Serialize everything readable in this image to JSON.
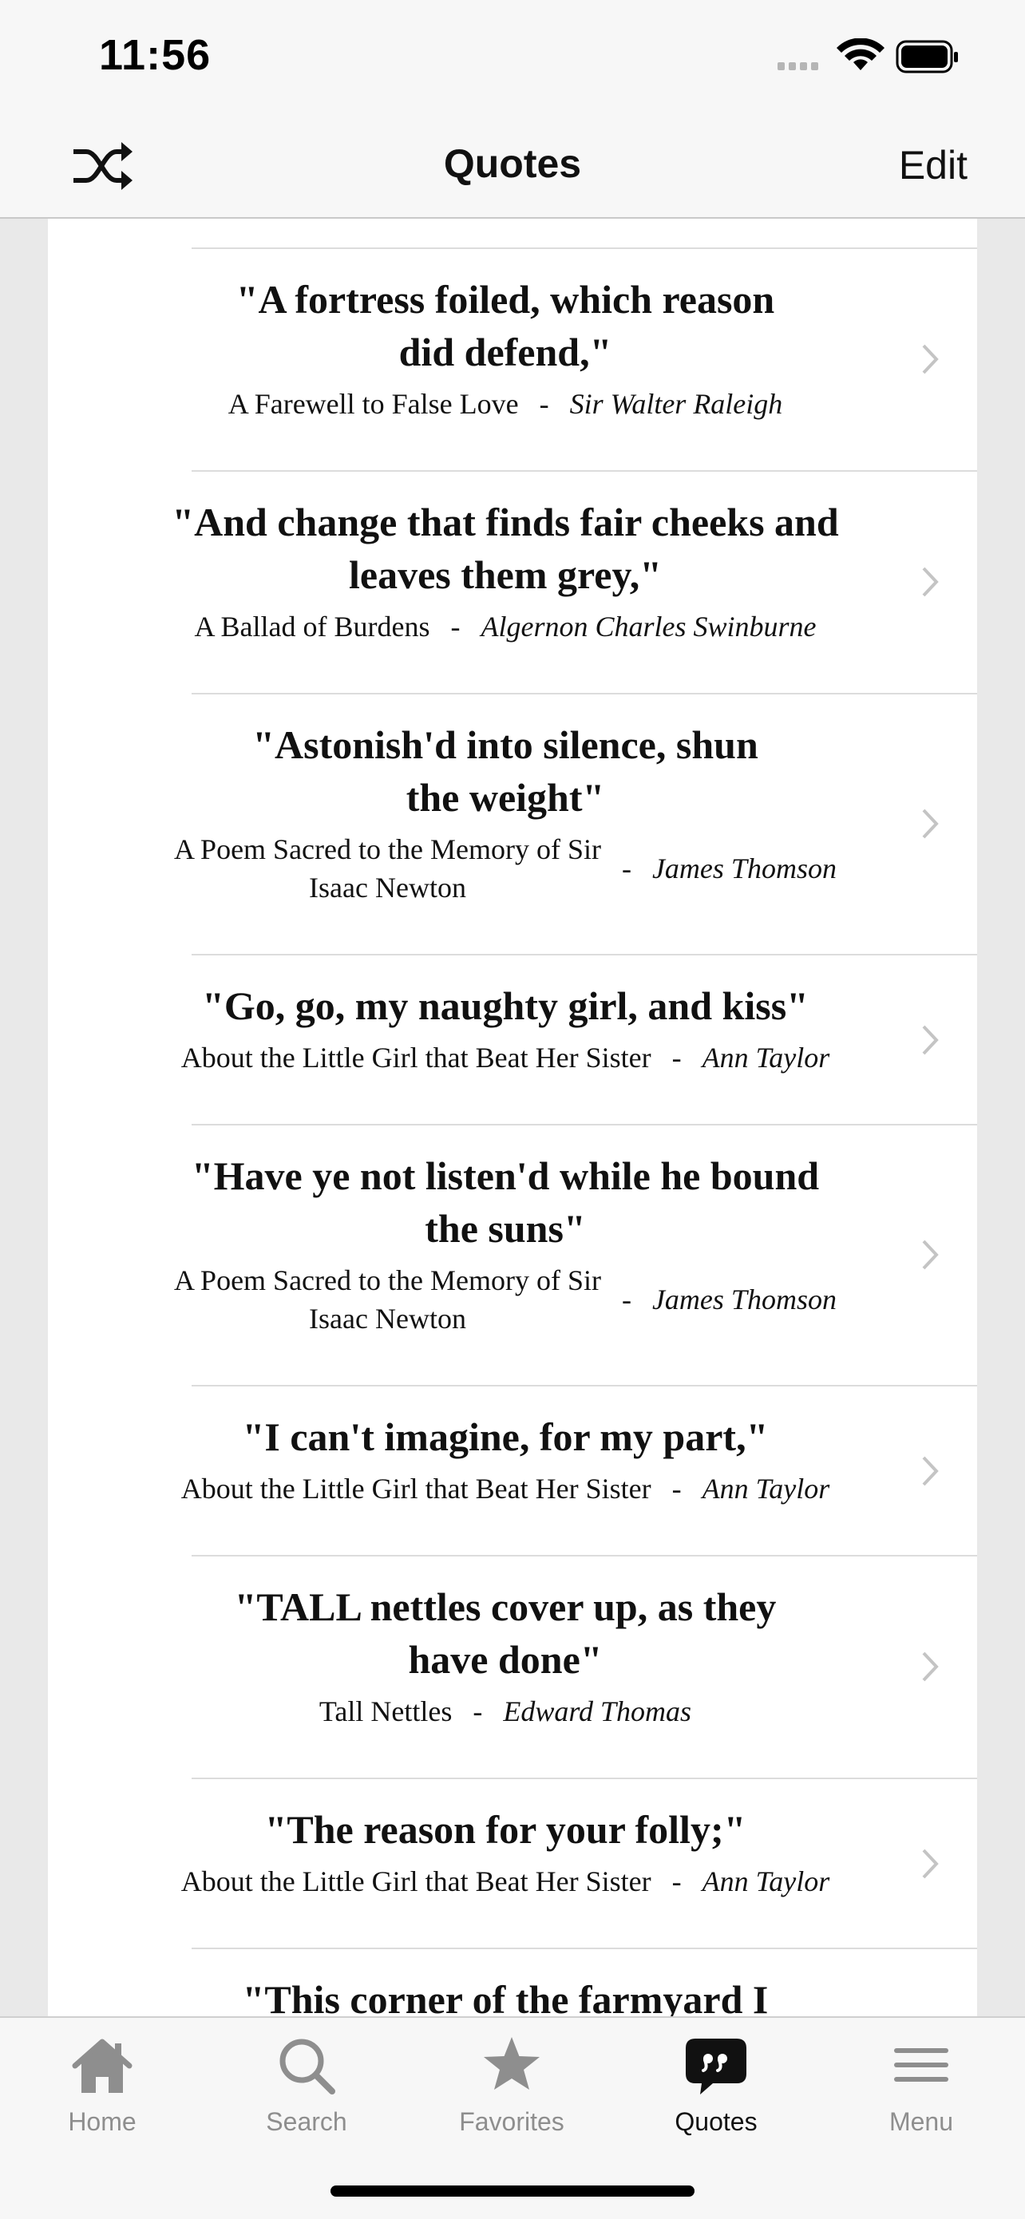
{
  "status_bar": {
    "time": "11:56"
  },
  "nav": {
    "title": "Quotes",
    "left_icon": "shuffle-icon",
    "right_label": "Edit"
  },
  "quotes": [
    {
      "quote_lines": [
        "\"A fortress foiled, which reason",
        "did defend,\""
      ],
      "source_lines": [
        "A Farewell to False Love"
      ],
      "author": "Sir Walter Raleigh"
    },
    {
      "quote_lines": [
        "\"And change that finds fair cheeks and",
        "leaves them grey,\""
      ],
      "source_lines": [
        "A Ballad of Burdens"
      ],
      "author": "Algernon Charles Swinburne"
    },
    {
      "quote_lines": [
        "\"Astonish'd into silence, shun",
        "the weight\""
      ],
      "source_lines": [
        "A Poem Sacred to the Memory of Sir",
        "Isaac Newton"
      ],
      "author": "James Thomson"
    },
    {
      "quote_lines": [
        "\"Go, go, my naughty girl, and kiss\""
      ],
      "source_lines": [
        "About the Little Girl that Beat Her Sister"
      ],
      "author": "Ann Taylor"
    },
    {
      "quote_lines": [
        "\"Have ye not listen'd while he bound",
        "the suns\""
      ],
      "source_lines": [
        "A Poem Sacred to the Memory of Sir",
        "Isaac Newton"
      ],
      "author": "James Thomson"
    },
    {
      "quote_lines": [
        "\"I can't imagine, for my part,\""
      ],
      "source_lines": [
        "About the Little Girl that Beat Her Sister"
      ],
      "author": "Ann Taylor"
    },
    {
      "quote_lines": [
        "\"TALL nettles cover up, as they",
        "have done\""
      ],
      "source_lines": [
        "Tall Nettles"
      ],
      "author": "Edward Thomas"
    },
    {
      "quote_lines": [
        "\"The reason for your folly;\""
      ],
      "source_lines": [
        "About the Little Girl that Beat Her Sister"
      ],
      "author": "Ann Taylor"
    },
    {
      "quote_lines": [
        "\"This corner of the farmyard I"
      ],
      "source_lines": [],
      "author": ""
    }
  ],
  "separator": "-",
  "tabs": [
    {
      "label": "Home",
      "icon": "home-icon",
      "active": false
    },
    {
      "label": "Search",
      "icon": "search-icon",
      "active": false
    },
    {
      "label": "Favorites",
      "icon": "star-icon",
      "active": false
    },
    {
      "label": "Quotes",
      "icon": "quote-bubble-icon",
      "active": true
    },
    {
      "label": "Menu",
      "icon": "menu-icon",
      "active": false
    }
  ],
  "colors": {
    "text": "#111111",
    "inactive_tab": "#8e8e8e",
    "chevron": "#c4c4c4",
    "background": "#ededed"
  }
}
